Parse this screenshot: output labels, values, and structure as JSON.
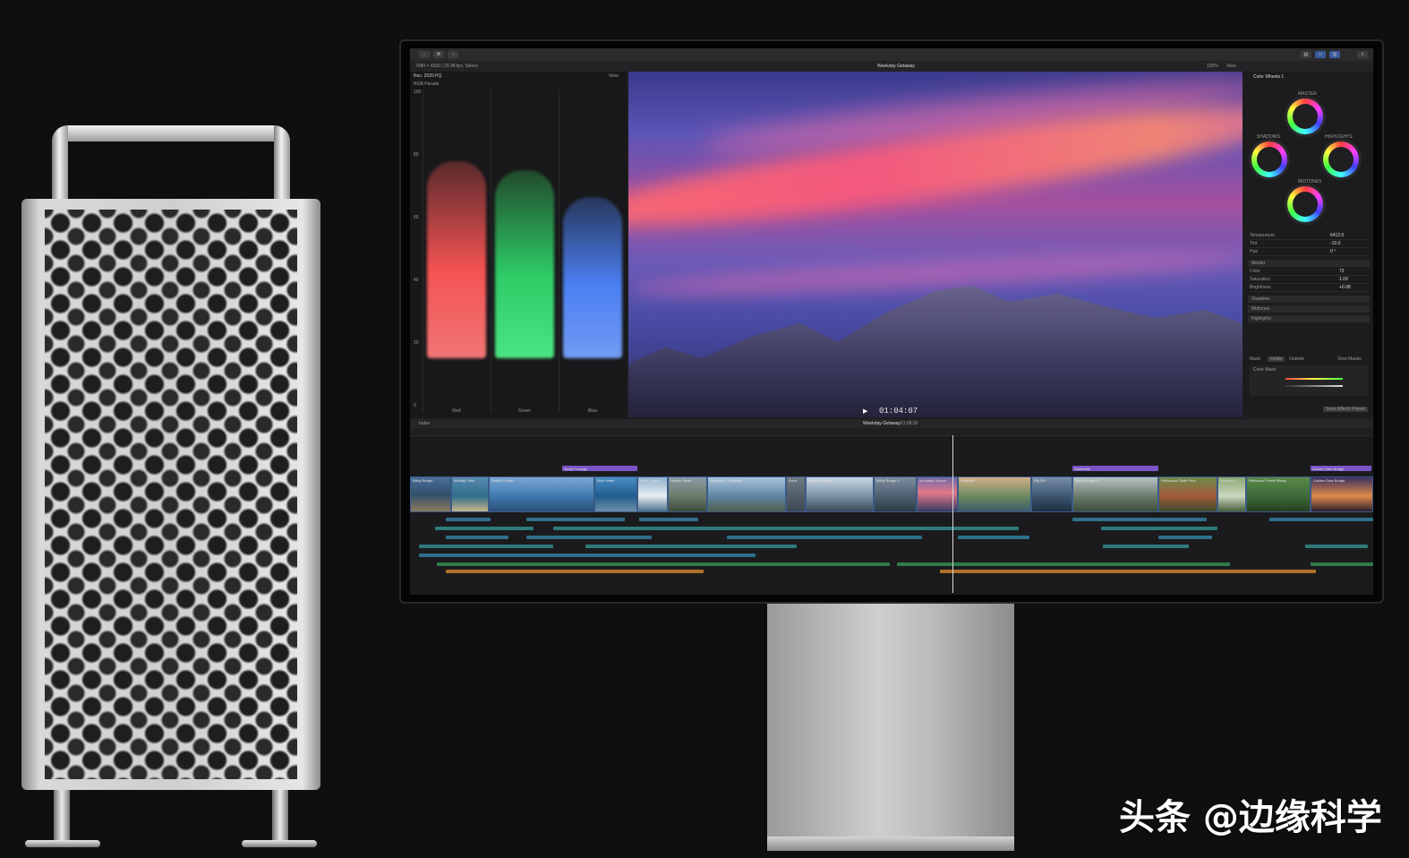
{
  "tower": {
    "name": "Mac Pro"
  },
  "app": {
    "info_left": "7680 × 4320 | 23.98 fps, Stereo",
    "project_title": "Weekday Getaway",
    "zoom": "100%",
    "view_label": "View",
    "scope_label": "Rec. 2020 PQ",
    "scope_sublabel": "RGB Parade",
    "scope_channels": [
      "Red",
      "Green",
      "Blue"
    ],
    "scope_ticks": [
      "100",
      "80",
      "60",
      "40",
      "20",
      "0"
    ],
    "timecode": "01:04:07",
    "inspector": {
      "title": "Color Wheels 1",
      "wheels": [
        "MASTER",
        "SHADOWS",
        "HIGHLIGHTS",
        "MIDTONES"
      ],
      "params": [
        {
          "label": "Temperature",
          "value": "6412.0"
        },
        {
          "label": "Tint",
          "value": "-10.0"
        },
        {
          "label": "Hue",
          "value": "0 °"
        }
      ],
      "sections": [
        "Master",
        "Shadows",
        "Midtones",
        "Highlights"
      ],
      "section_params": [
        {
          "label": "Color",
          "value": "73"
        },
        {
          "label": "Saturation",
          "value": "1.09"
        },
        {
          "label": "Brightness",
          "value": "+0.08"
        }
      ],
      "mask_label": "Mask",
      "mask_tabs": [
        "Inside",
        "Outside"
      ],
      "view_masks": "View Masks",
      "color_mask": "Color Mask",
      "save_button": "Save Effects Preset"
    },
    "timeline": {
      "index_label": "Index",
      "title": "Weekday Getaway",
      "duration": "01:08:30",
      "clips": [
        "Bixby Bridge",
        "McWay Falls",
        "Pacific Ocean",
        "Blue Water",
        "Point Lobos",
        "Harbor Seals",
        "Highway 1 Coastline",
        "Rock",
        "Majestic Views",
        "Bixby Bridge 2",
        "Mountain Sunset",
        "Waterfall",
        "Big Sur",
        "Bixby Bridge 3",
        "Redwoods State Park",
        "Waterfall 2",
        "Redwood Forest Hiking",
        "Golden Gate Bridge"
      ],
      "titles": [
        "Aerial Footage",
        "Waterfalls",
        "Golden Gate Bridge"
      ]
    }
  },
  "watermark": "头条 @边缘科学"
}
